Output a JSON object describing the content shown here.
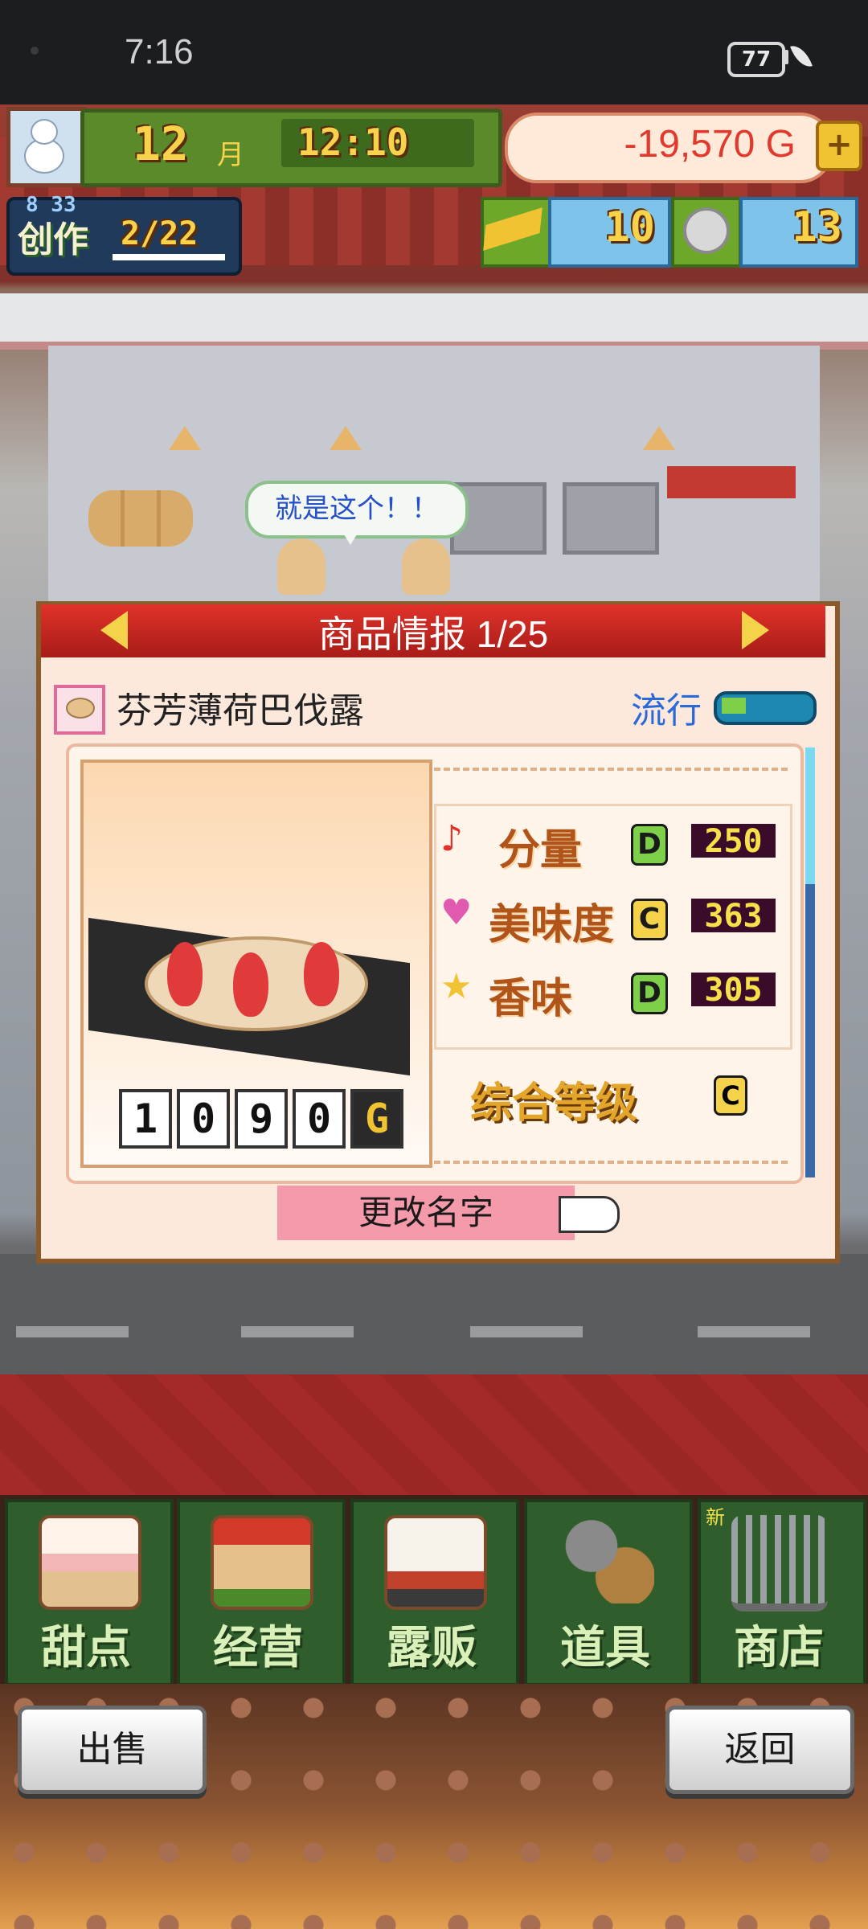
{
  "status_bar": {
    "time": "7:16",
    "battery": "77"
  },
  "hud": {
    "month": "12",
    "month_unit": "月",
    "time": "12:10",
    "money": "-19,570 G",
    "add_money": "+",
    "create_label": "创作",
    "create_top": "8 33",
    "create_count": "2/22",
    "gold_count": "10",
    "coin_count": "13"
  },
  "speech": "就是这个！！",
  "dialog": {
    "title": "商品情报 1/25",
    "item_name": "芬芳薄荷巴伐露",
    "trend_label": "流行",
    "trend_level": 0.3,
    "price_digits": [
      "1",
      "0",
      "9",
      "0"
    ],
    "price_unit": "G",
    "stats": [
      {
        "icon": "♪",
        "label": "分量",
        "grade": "D",
        "value": "250"
      },
      {
        "icon": "♥",
        "label": "美味度",
        "grade": "C",
        "value": "363"
      },
      {
        "icon": "★",
        "label": "香味",
        "grade": "D",
        "value": "305"
      }
    ],
    "overall_label": "综合等级",
    "overall_grade": "C",
    "rename_button": "更改名字"
  },
  "menu": {
    "items": [
      "甜点",
      "经营",
      "露贩",
      "道具",
      "商店"
    ],
    "new_badge": "新"
  },
  "bottom": {
    "sell": "出售",
    "back": "返回"
  },
  "colors": {
    "accent_red": "#e0322a",
    "dialog_bg": "#fde8dc",
    "menu_green": "#2f5e2c"
  },
  "icons": [
    "snowman-icon",
    "gold-bar-icon",
    "coin-icon",
    "music-note-icon",
    "heart-icon",
    "star-icon",
    "pointing-hand-icon",
    "cart-icon"
  ]
}
